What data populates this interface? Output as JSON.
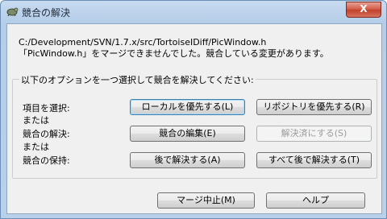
{
  "window": {
    "title": "競合の解決",
    "close_label": "X"
  },
  "message": {
    "path": "C:/Development/SVN/1.7.x/src/TortoiseIDiff/PicWindow.h",
    "text": "「PicWindow.h」をマージできませんでした。競合している変更があります。"
  },
  "options_group": {
    "caption": "以下のオプションを一つ選択して競合を解決してください:",
    "label_select_item": "項目を選択:",
    "label_or_1": "または",
    "label_resolve": "競合の解決:",
    "label_or_2": "または",
    "label_keep": "競合の保持:"
  },
  "buttons": {
    "prefer_local": "ローカルを優先する(L)",
    "prefer_repository": "リポジトリを優先する(R)",
    "edit_conflict": "競合の編集(E)",
    "mark_resolved": "解決済にする(S)",
    "resolve_later": "後で解決する(A)",
    "resolve_all_later": "すべて後で解決する(T)",
    "abort_merge": "マージ中止(M)",
    "help": "ヘルプ"
  }
}
